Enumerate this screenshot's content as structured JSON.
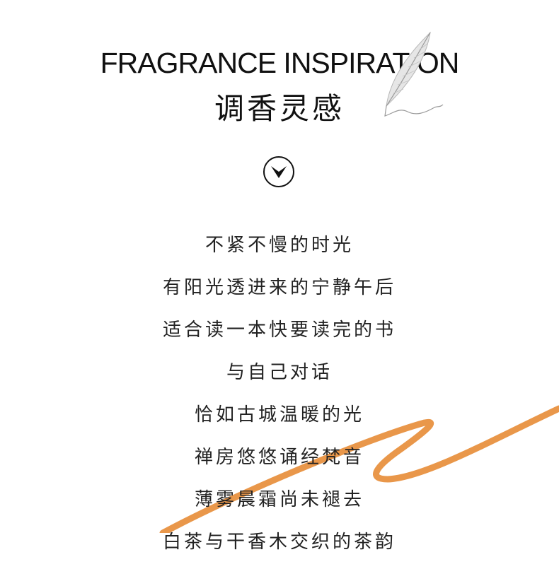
{
  "header": {
    "title_en": "FRAGRANCE INSPIRATION",
    "title_cn": "调香灵感"
  },
  "icons": {
    "feather": "feather-quill-icon",
    "scroll": "chevron-down-circle-icon"
  },
  "poem": {
    "lines": [
      "不紧不慢的时光",
      "有阳光透进来的宁静午后",
      "适合读一本快要读完的书",
      "与自己对话",
      "恰如古城温暖的光",
      "禅房悠悠诵经梵音",
      "薄雾晨霜尚未褪去",
      "白茶与干香木交织的茶韵"
    ]
  },
  "colors": {
    "accent_brush": "#E9974A",
    "text": "#222222",
    "background": "#FFFFFF"
  }
}
